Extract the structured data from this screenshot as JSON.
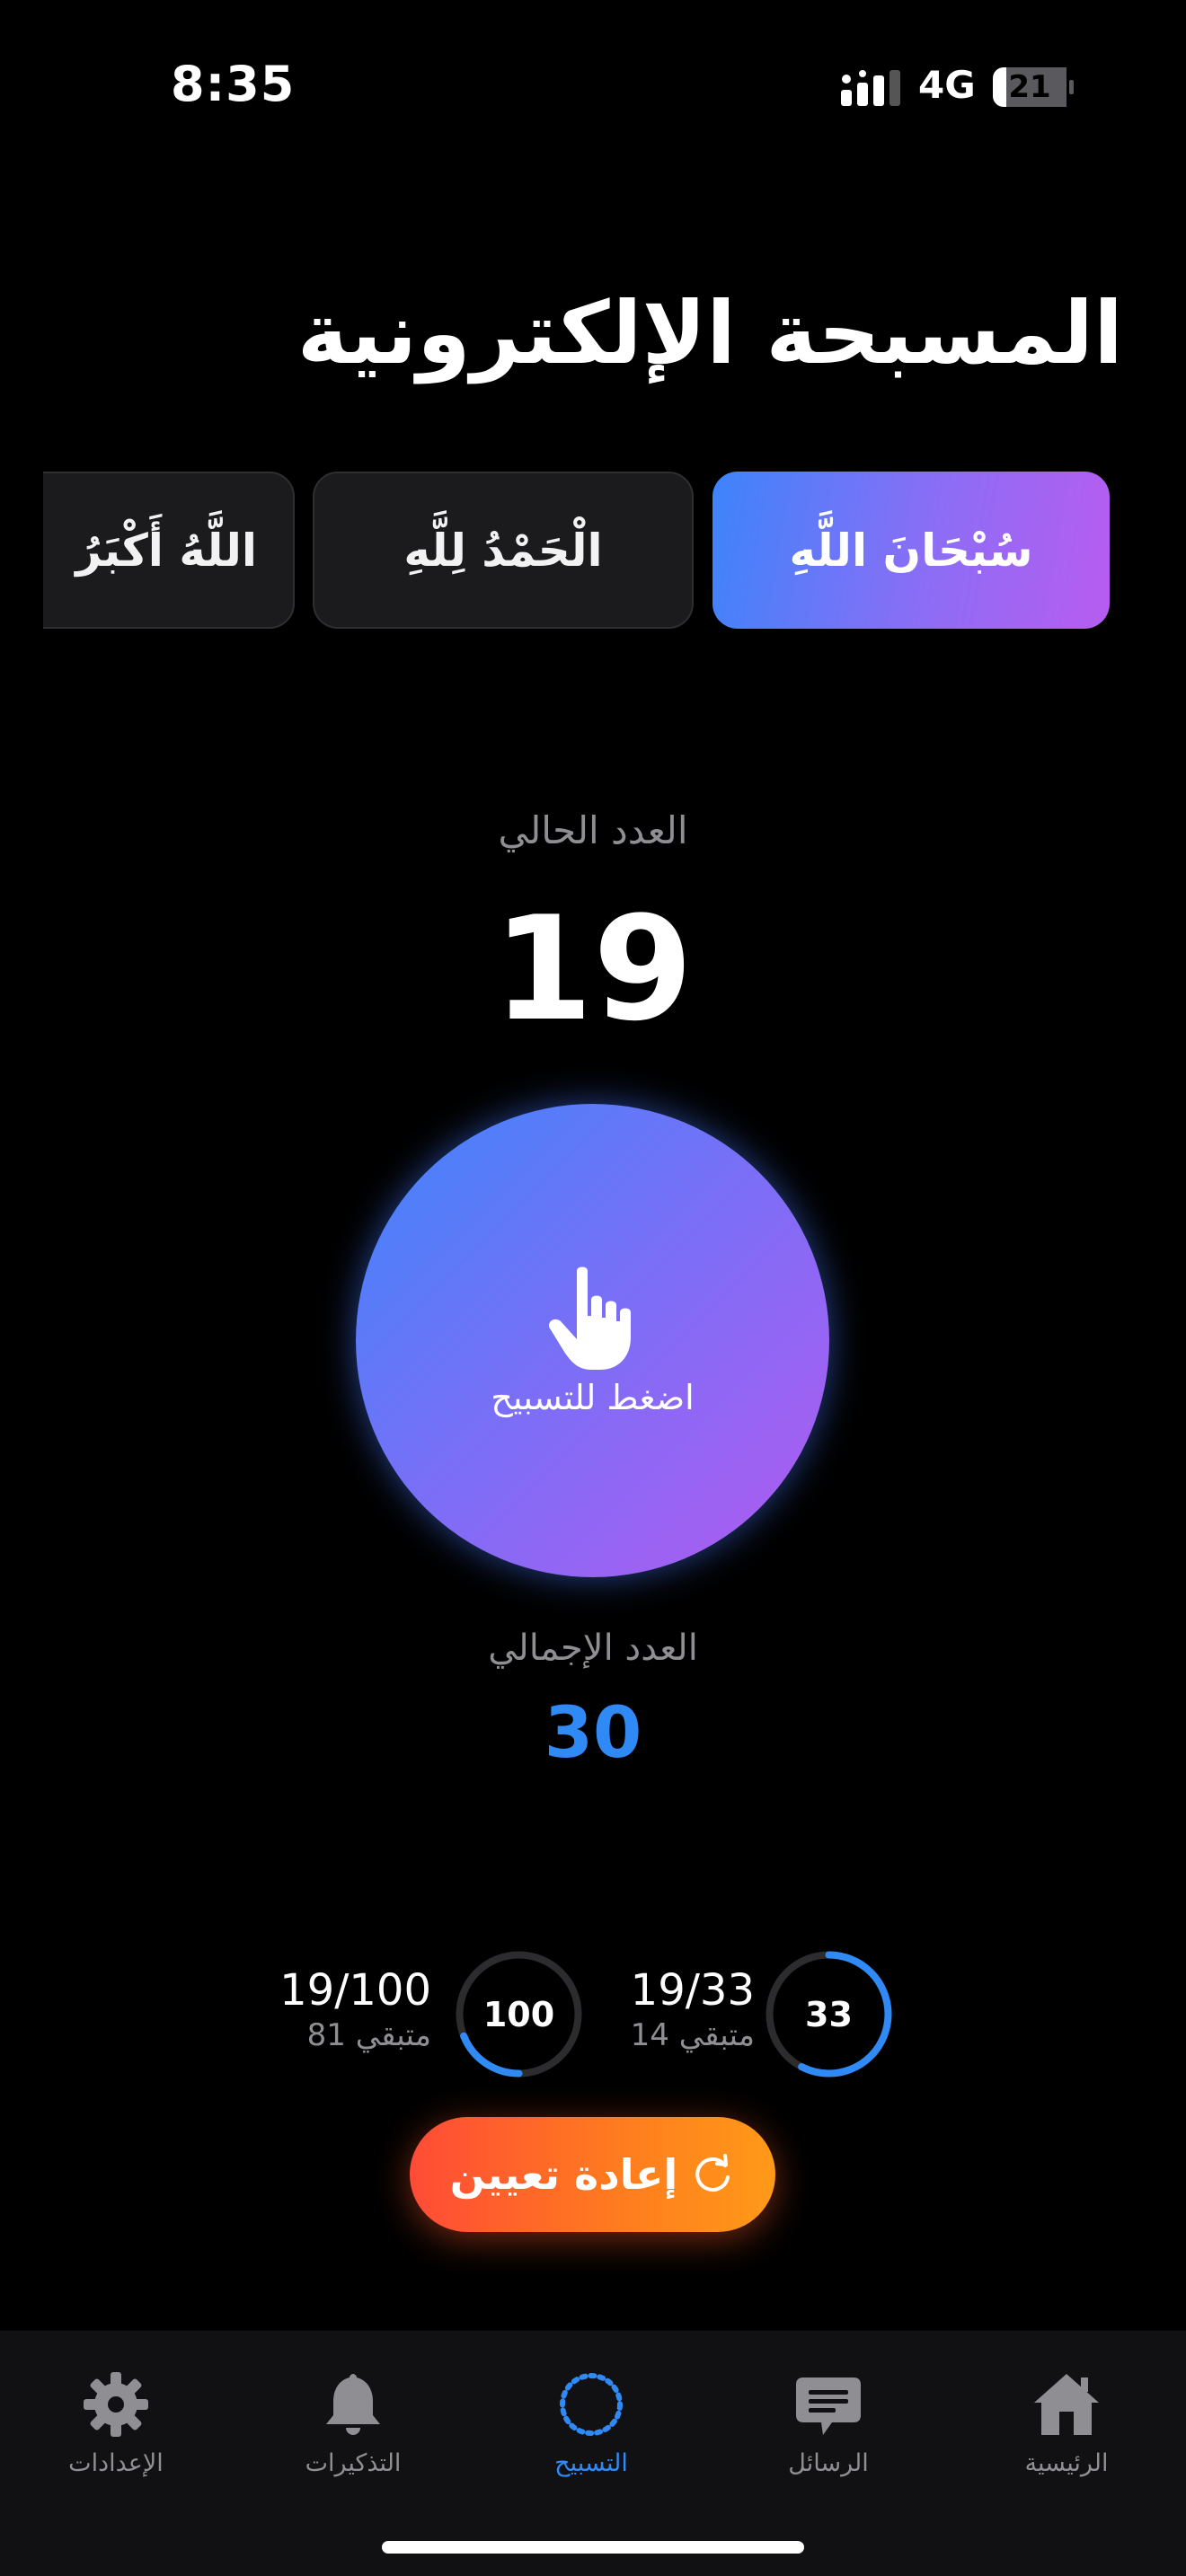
{
  "status": {
    "time": "8:35",
    "network": "4G",
    "battery": "21"
  },
  "title": "المسبحة الإلكترونية",
  "dhikr": [
    {
      "label": "سُبْحَانَ اللَّهِ",
      "active": true
    },
    {
      "label": "الْحَمْدُ لِلَّهِ",
      "active": false
    },
    {
      "label": "اللَّهُ أَكْبَرُ",
      "active": false
    }
  ],
  "counter": {
    "current_label": "العدد الحالي",
    "current": "19",
    "tap_label": "اضغط للتسبيح",
    "total_label": "العدد الإجمالي",
    "total": "30"
  },
  "goals": [
    {
      "target": "33",
      "fraction": "19/33",
      "remaining": "متبقي 14",
      "progress": 0.5758
    },
    {
      "target": "100",
      "fraction": "19/100",
      "remaining": "متبقي 81",
      "progress": 0.19
    }
  ],
  "reset_label": "إعادة تعيين",
  "tabs": [
    {
      "label": "الرئيسية",
      "icon": "home-icon"
    },
    {
      "label": "الرسائل",
      "icon": "message-icon"
    },
    {
      "label": "التسبيح",
      "icon": "tasbih-beads-icon",
      "active": true
    },
    {
      "label": "التذكيرات",
      "icon": "bell-icon"
    },
    {
      "label": "الإعدادات",
      "icon": "gear-icon"
    }
  ],
  "colors": {
    "accent": "#2f8af5",
    "reset": "#ff6a2a",
    "gradient_start": "#3d86fb",
    "gradient_end": "#b35af0"
  }
}
